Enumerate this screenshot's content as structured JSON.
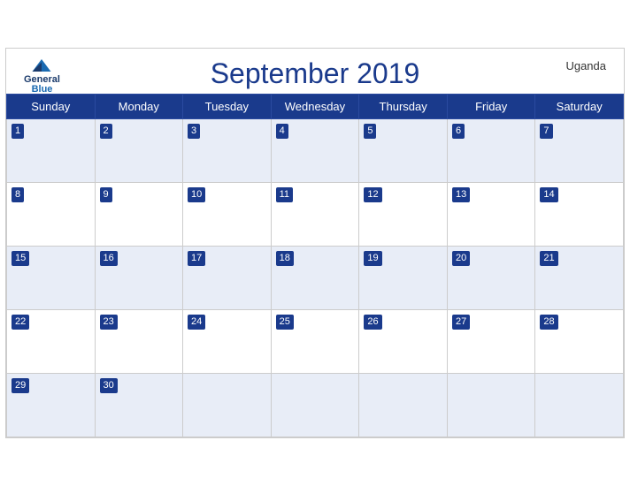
{
  "header": {
    "title": "September 2019",
    "country": "Uganda",
    "logo": {
      "general": "General",
      "blue": "Blue"
    }
  },
  "weekdays": [
    "Sunday",
    "Monday",
    "Tuesday",
    "Wednesday",
    "Thursday",
    "Friday",
    "Saturday"
  ],
  "weeks": [
    [
      1,
      2,
      3,
      4,
      5,
      6,
      7
    ],
    [
      8,
      9,
      10,
      11,
      12,
      13,
      14
    ],
    [
      15,
      16,
      17,
      18,
      19,
      20,
      21
    ],
    [
      22,
      23,
      24,
      25,
      26,
      27,
      28
    ],
    [
      29,
      30,
      null,
      null,
      null,
      null,
      null
    ]
  ],
  "colors": {
    "header_bg": "#1a3a8c",
    "row_shade": "#e8edf7",
    "row_white": "#ffffff",
    "day_num_bg": "#1a3a8c",
    "day_num_text": "#ffffff"
  }
}
